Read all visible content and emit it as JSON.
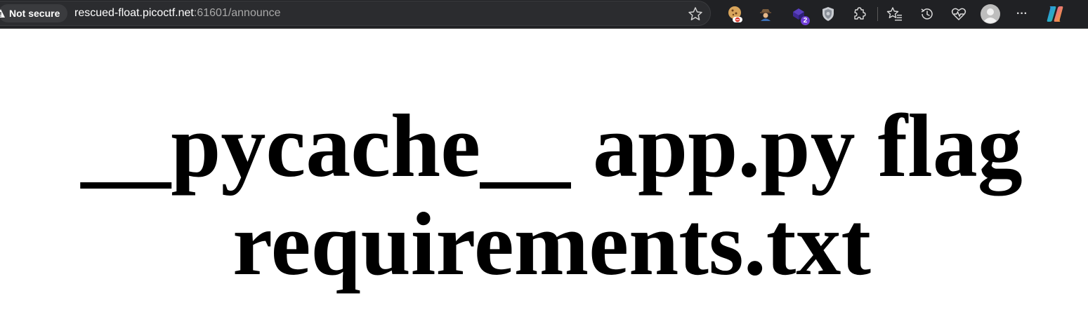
{
  "browser": {
    "security_chip": "Not secure",
    "url_host": "rescued-float.picoctf.net",
    "url_rest": ":61601/announce",
    "toolbar_icons": [
      "cookie-extension-icon",
      "detective-extension-icon",
      "notification-extension-icon",
      "shield-extension-icon",
      "extensions-icon",
      "favorites-icon",
      "history-icon",
      "browser-essentials-icon",
      "profile-avatar",
      "more-icon",
      "copilot-icon"
    ],
    "extension_badge": "2",
    "more_label": "···"
  },
  "page": {
    "listing": "__pycache__ app.py flag requirements.txt"
  },
  "colors": {
    "toolbar_bg": "#202124",
    "page_bg": "#ffffff",
    "text": "#000000"
  }
}
